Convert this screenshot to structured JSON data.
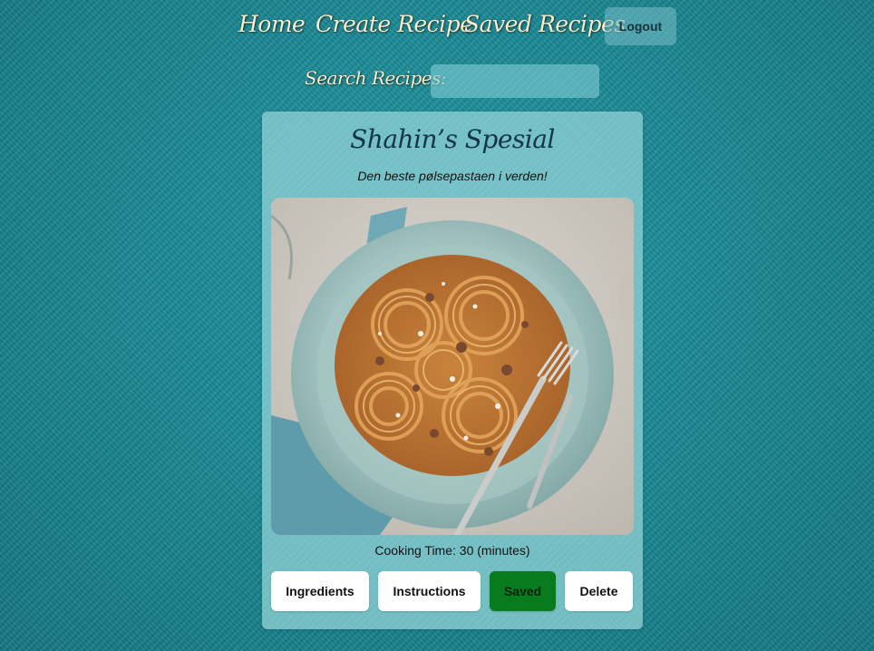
{
  "nav": {
    "home": "Home",
    "create_recipe": "Create Recipe",
    "saved_recipes": "Saved Recipes",
    "logout": "Logout"
  },
  "search": {
    "label": "Search Recipes:",
    "value": ""
  },
  "recipe": {
    "title": "Shahin’s Spesial",
    "description": "Den beste pølsepastaen i verden!",
    "image_icon": "pasta-bolognese-photo",
    "cooking_time": "Cooking Time: 30 (minutes)",
    "buttons": {
      "ingredients": "Ingredients",
      "instructions": "Instructions",
      "saved": "Saved",
      "delete": "Delete"
    }
  },
  "colors": {
    "background": "#1a8a96",
    "nav_text": "#f6f1cf",
    "card": "#96d6da",
    "saved_button": "#077b1d",
    "title_text": "#12354a"
  }
}
